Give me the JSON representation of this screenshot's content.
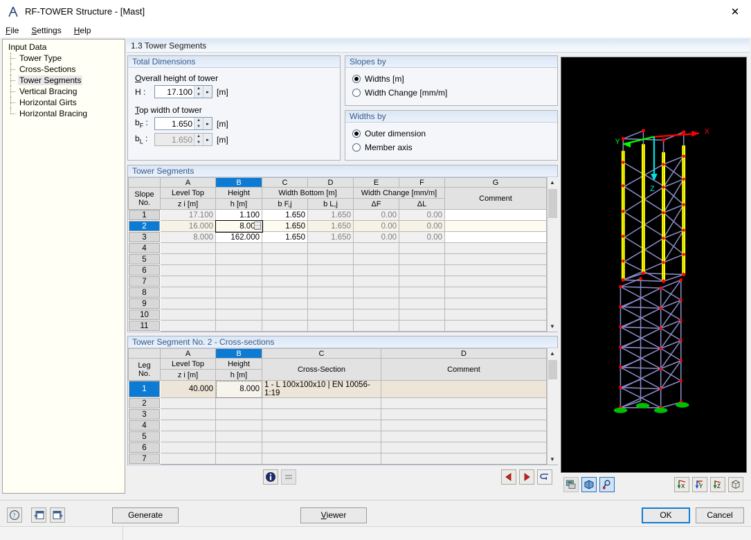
{
  "window": {
    "title": "RF-TOWER Structure - [Mast]",
    "app_icon": "tower-app-icon",
    "close_label": "✕"
  },
  "menu": [
    {
      "label": "File",
      "accel": "F"
    },
    {
      "label": "Settings",
      "accel": "S"
    },
    {
      "label": "Help",
      "accel": "H"
    }
  ],
  "sidebar": {
    "root": "Input Data",
    "items": [
      {
        "label": "Tower Type",
        "selected": false
      },
      {
        "label": "Cross-Sections",
        "selected": false
      },
      {
        "label": "Tower Segments",
        "selected": true
      },
      {
        "label": "Vertical Bracing",
        "selected": false
      },
      {
        "label": "Horizontal Girts",
        "selected": false
      },
      {
        "label": "Horizontal Bracing",
        "selected": false
      }
    ]
  },
  "section_header": "1.3 Tower Segments",
  "total_dimensions": {
    "title": "Total Dimensions",
    "overall_label": "Overall height of tower",
    "overall_accel": "O",
    "h_name": "H :",
    "h_value": "17.100",
    "h_unit": "[m]",
    "top_width_label": "Top width of tower",
    "top_width_accel": "T",
    "bf_name": "b F :",
    "bf_value": "1.650",
    "bf_unit": "[m]",
    "bl_name": "b L :",
    "bl_value": "1.650",
    "bl_unit": "[m]",
    "bl_disabled": true
  },
  "slopes_by": {
    "title": "Slopes by",
    "options": [
      {
        "label": "Widths [m]",
        "selected": true
      },
      {
        "label": "Width Change [mm/m]",
        "selected": false
      }
    ]
  },
  "widths_by": {
    "title": "Widths by",
    "options": [
      {
        "label": "Outer dimension",
        "selected": true
      },
      {
        "label": "Member axis",
        "selected": false
      }
    ]
  },
  "tower_segments": {
    "title": "Tower Segments",
    "column_letters": [
      "A",
      "B",
      "C",
      "D",
      "E",
      "F",
      "G"
    ],
    "selected_column": "B",
    "rowno_header_line1": "Slope",
    "rowno_header_line2": "No.",
    "headers": [
      {
        "line1": "Level Top",
        "line2": "z i [m]"
      },
      {
        "line1": "Height",
        "line2": "h [m]"
      },
      {
        "line1": "Width Bottom [m]",
        "line2": "b F,j"
      },
      {
        "line1": "",
        "line2": "b L,j"
      },
      {
        "line1": "Width Change [mm/m]",
        "line2": "ΔF"
      },
      {
        "line1": "",
        "line2": "ΔL"
      },
      {
        "line1": "",
        "line2": "Comment"
      }
    ],
    "rows": [
      {
        "no": "1",
        "level_top": "17.100",
        "height": "1.100",
        "bf": "1.650",
        "bl": "1.650",
        "df": "0.00",
        "dl": "0.00",
        "comment": "",
        "selected": false,
        "editing": false
      },
      {
        "no": "2",
        "level_top": "16.000",
        "height": "8.000",
        "bf": "1.650",
        "bl": "1.650",
        "df": "0.00",
        "dl": "0.00",
        "comment": "",
        "selected": true,
        "editing": true
      },
      {
        "no": "3",
        "level_top": "8.000",
        "height": "162.000",
        "bf": "1.650",
        "bl": "1.650",
        "df": "0.00",
        "dl": "0.00",
        "comment": "",
        "selected": false,
        "editing": false
      },
      {
        "no": "4"
      },
      {
        "no": "5"
      },
      {
        "no": "6"
      },
      {
        "no": "7"
      },
      {
        "no": "8"
      },
      {
        "no": "9"
      },
      {
        "no": "10"
      },
      {
        "no": "11"
      }
    ]
  },
  "cross_sections": {
    "title": "Tower Segment No. 2  -  Cross-sections",
    "column_letters": [
      "A",
      "B",
      "C",
      "D"
    ],
    "selected_column": "B",
    "rowno_header_line1": "Leg",
    "rowno_header_line2": "No.",
    "headers": [
      {
        "line1": "Level Top",
        "line2": "z i [m]"
      },
      {
        "line1": "Height",
        "line2": "h [m]"
      },
      {
        "line1": "",
        "line2": "Cross-Section"
      },
      {
        "line1": "",
        "line2": "Comment"
      }
    ],
    "rows": [
      {
        "no": "1",
        "level_top": "40.000",
        "height": "8.000",
        "cross_section": "1 - L 100x100x10 | EN 10056-1:19",
        "comment": "",
        "selected": true
      },
      {
        "no": "2"
      },
      {
        "no": "3"
      },
      {
        "no": "4"
      },
      {
        "no": "5"
      },
      {
        "no": "6"
      },
      {
        "no": "7"
      }
    ]
  },
  "table_toolbar": {
    "info_icon": "info-icon",
    "list_icon": "list-icon",
    "prev_icon": "prev-triangle-icon",
    "next_icon": "next-triangle-icon",
    "apply_icon": "apply-arrow-icon"
  },
  "view_toolbar": {
    "render_icon": "render-mode-icon",
    "shade_icon": "shaded-view-icon",
    "select_icon": "pick-object-icon",
    "view_x_icon": "view-in-x-icon",
    "view_x_label": "X",
    "view_y_icon": "view-in-y-icon",
    "view_y_label": "Y",
    "view_z_icon": "view-in-z-icon",
    "view_z_label": "Z",
    "iso_icon": "isometric-view-icon"
  },
  "viewport": {
    "axis_x": "X",
    "axis_y": "Y",
    "axis_z": "Z",
    "colors": {
      "background": "#000000",
      "member": "#8080c0",
      "highlight_leg": "#ffff00",
      "node": "#ff0000",
      "support": "#00c000",
      "axis_x": "#ff0000",
      "axis_y": "#00ff00",
      "axis_z": "#00e0e0"
    }
  },
  "bottom_bar": {
    "help_icon": "help-question-icon",
    "back_icon": "back-arrow-icon",
    "forward_icon": "forward-arrow-icon",
    "generate_label": "Generate",
    "viewer_label": "Viewer",
    "viewer_accel": "V",
    "ok_label": "OK",
    "cancel_label": "Cancel"
  }
}
